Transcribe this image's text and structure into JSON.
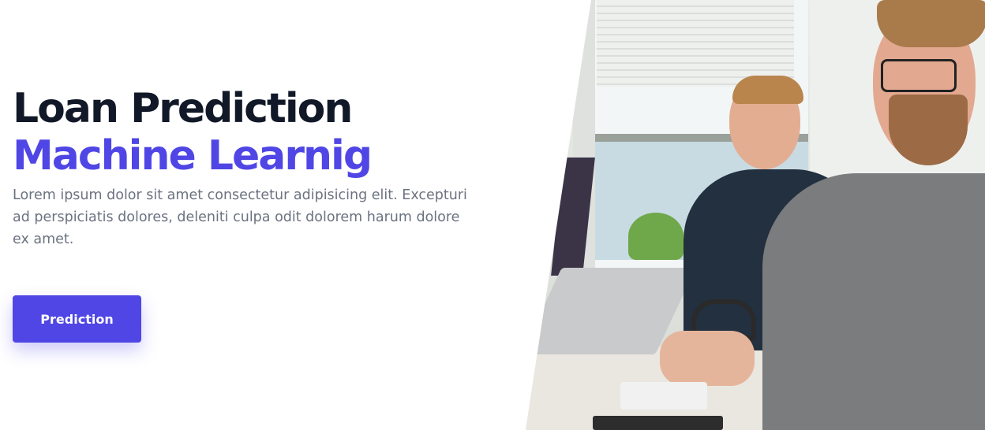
{
  "hero": {
    "title_line1": "Loan Prediction",
    "title_line2": "Machine Learnig",
    "description": "Lorem ipsum dolor sit amet consectetur adipisicing elit. Excepturi ad perspiciatis dolores, deleniti culpa odit dolorem harum dolore ex amet.",
    "cta_label": "Prediction"
  },
  "colors": {
    "accent": "#4f46e5",
    "heading": "#111827",
    "body_text": "#6b7280"
  }
}
